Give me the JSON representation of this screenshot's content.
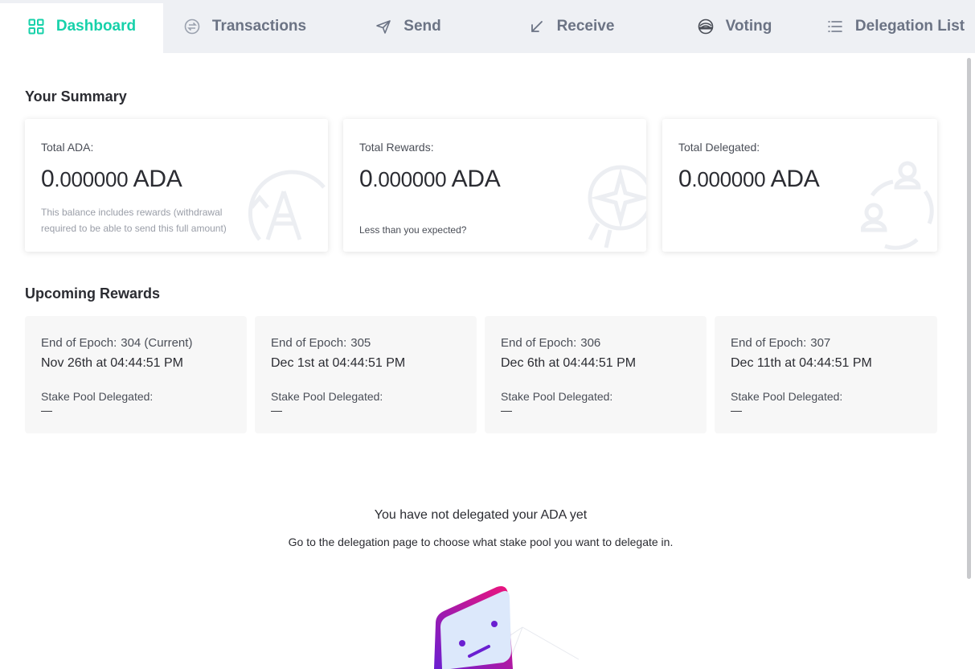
{
  "tabs": [
    {
      "label": "Dashboard",
      "icon": "dashboard-icon",
      "active": true
    },
    {
      "label": "Transactions",
      "icon": "transactions-icon",
      "active": false
    },
    {
      "label": "Send",
      "icon": "send-icon",
      "active": false
    },
    {
      "label": "Receive",
      "icon": "receive-icon",
      "active": false
    },
    {
      "label": "Voting",
      "icon": "voting-icon",
      "active": false
    },
    {
      "label": "Delegation List",
      "icon": "list-icon",
      "active": false
    }
  ],
  "summary": {
    "title": "Your Summary",
    "total_ada": {
      "label": "Total ADA:",
      "int": "0",
      "dec": ".000000",
      "unit": " ADA",
      "note": "This balance includes rewards (withdrawal required to be able to send this full amount)"
    },
    "total_rewards": {
      "label": "Total Rewards:",
      "int": "0",
      "dec": ".000000",
      "unit": " ADA",
      "link": "Less than you expected?"
    },
    "total_delegated": {
      "label": "Total Delegated:",
      "int": "0",
      "dec": ".000000",
      "unit": " ADA"
    }
  },
  "upcoming": {
    "title": "Upcoming Rewards",
    "epochs": [
      {
        "label": "End of Epoch:",
        "num": "304 (Current)",
        "date": "Nov 26th at 04:44:51 PM",
        "pool_label": "Stake Pool Delegated:",
        "pool": "—"
      },
      {
        "label": "End of Epoch:",
        "num": "305",
        "date": "Dec 1st at 04:44:51 PM",
        "pool_label": "Stake Pool Delegated:",
        "pool": "—"
      },
      {
        "label": "End of Epoch:",
        "num": "306",
        "date": "Dec 6th at 04:44:51 PM",
        "pool_label": "Stake Pool Delegated:",
        "pool": "—"
      },
      {
        "label": "End of Epoch:",
        "num": "307",
        "date": "Dec 11th at 04:44:51 PM",
        "pool_label": "Stake Pool Delegated:",
        "pool": "—"
      }
    ]
  },
  "empty": {
    "title": "You have not delegated your ADA yet",
    "subtitle": "Go to the delegation page to choose what stake pool you want to delegate in."
  },
  "colors": {
    "accent": "#17d1aa",
    "tab_bg": "#eef0f4",
    "tab_text": "#6b7384"
  }
}
